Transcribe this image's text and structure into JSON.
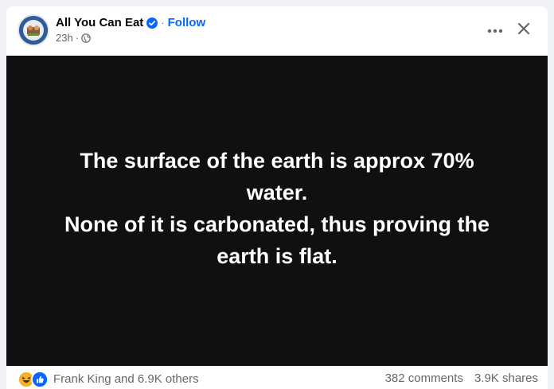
{
  "post": {
    "page_name": "All You Can Eat",
    "separator": "·",
    "follow_label": "Follow",
    "time": "23h",
    "time_separator": "·",
    "privacy_icon": "globe-icon",
    "verified_icon": "verified-badge-icon",
    "more_icon": "more-horizontal-icon",
    "close_icon": "close-icon"
  },
  "media": {
    "background": "#101010",
    "lines": [
      "The surface of the earth is approx 70%",
      "water.",
      "None of it is carbonated, thus proving the",
      "earth is flat."
    ]
  },
  "footer": {
    "reaction_icons": [
      "haha-icon",
      "like-icon"
    ],
    "reactions_text": "Frank King and 6.9K others",
    "comments": "382 comments",
    "shares": "3.9K shares"
  },
  "colors": {
    "accent": "#0866ff",
    "secondary_text": "#65676b",
    "primary_text": "#050505",
    "like": "#0866ff",
    "haha": "#f7b125"
  }
}
